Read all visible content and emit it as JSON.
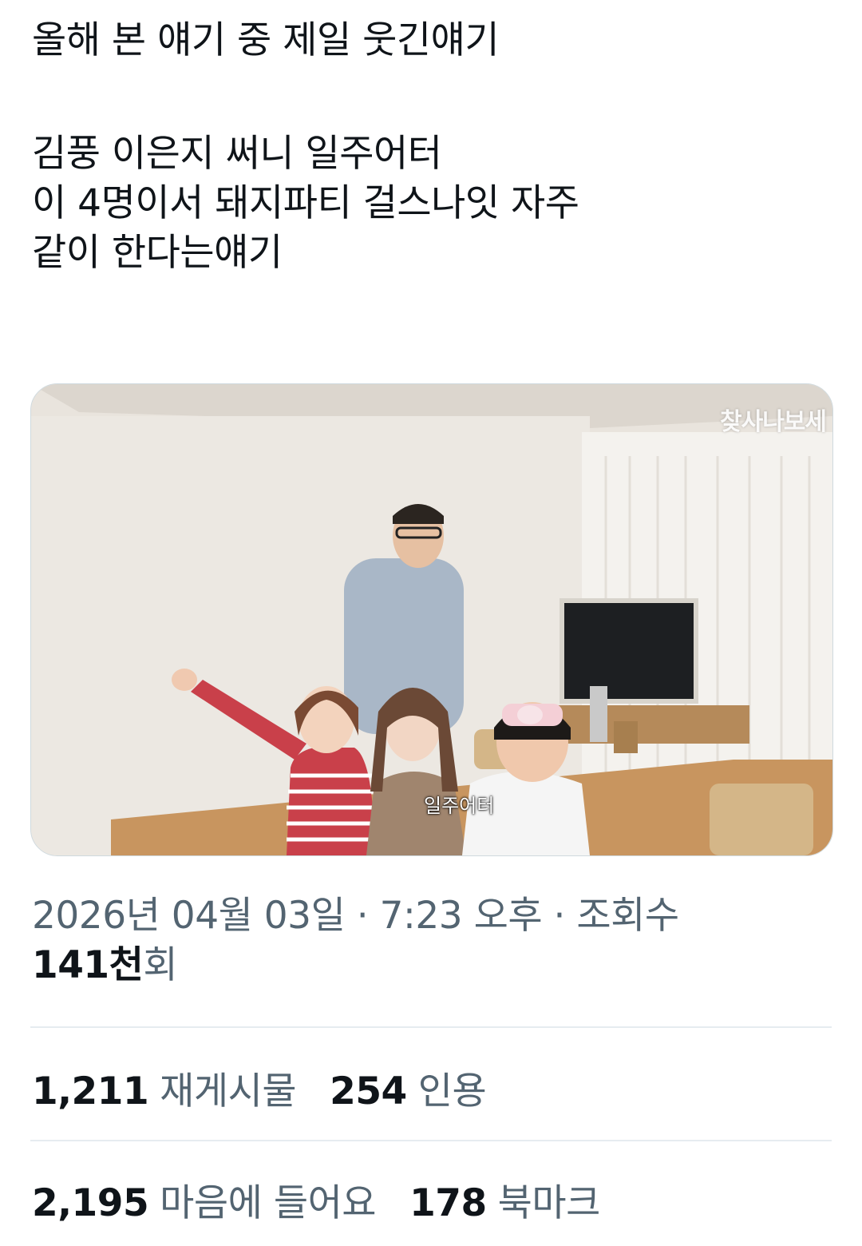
{
  "tweet": {
    "lines": [
      "올해 본 얘기 중 제일 웃긴얘기",
      "김풍 이은지 써니 일주어터",
      "이 4명이서 돼지파티 걸스나잇 자주",
      "같이 한다는얘기"
    ]
  },
  "media": {
    "watermark": "찾사나보세",
    "caption": "일주어터"
  },
  "meta": {
    "datetime": "2026년 04월 03일 · 7:23 오후 · 조회수",
    "views_count": "141천",
    "views_suffix": "회"
  },
  "stats": {
    "retweets": {
      "count": "1,211",
      "label": "재게시물"
    },
    "quotes": {
      "count": "254",
      "label": "인용"
    },
    "likes": {
      "count": "2,195",
      "label": "마음에 들어요"
    },
    "bookmarks": {
      "count": "178",
      "label": "북마크"
    }
  },
  "colors": {
    "text_primary": "#0f1419",
    "text_secondary": "#536471",
    "divider": "#e6ecf0"
  }
}
